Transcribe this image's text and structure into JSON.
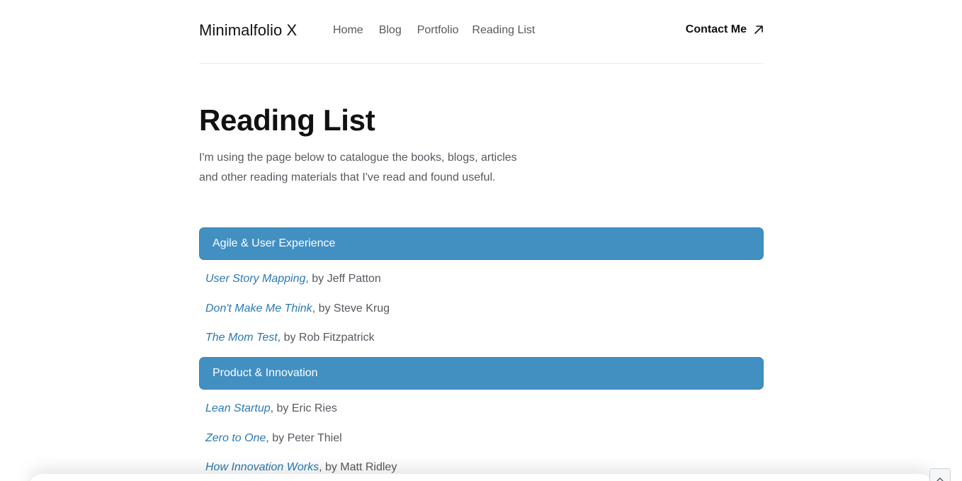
{
  "header": {
    "brand": "Minimalfolio X",
    "nav": [
      "Home",
      "Blog",
      "Portfolio",
      "Reading List"
    ],
    "contact_label": "Contact Me",
    "contact_icon": "arrow-up-right-icon"
  },
  "main": {
    "title": "Reading List",
    "intro": "I'm using the page below to catalogue the books, blogs, articles and other reading materials that I've read and found useful.",
    "sections": [
      {
        "heading": "Agile & User Experience",
        "items": [
          {
            "title": "User Story Mapping",
            "byline": ", by Jeff Patton"
          },
          {
            "title": "Don't Make Me Think",
            "byline": ", by Steve Krug"
          },
          {
            "title": "The Mom Test",
            "byline": ", by Rob Fitzpatrick"
          }
        ]
      },
      {
        "heading": "Product & Innovation",
        "items": [
          {
            "title": "Lean Startup",
            "byline": ", by Eric Ries"
          },
          {
            "title": "Zero to One",
            "byline": ", by Peter Thiel"
          },
          {
            "title": "How Innovation Works",
            "byline": ", by Matt Ridley"
          }
        ]
      }
    ]
  },
  "colors": {
    "accent": "#428fc2",
    "link": "#2a7ab0",
    "text_muted": "#555a5f",
    "text_dark": "#111111"
  },
  "scroll_top_icon": "chevron-up-icon"
}
